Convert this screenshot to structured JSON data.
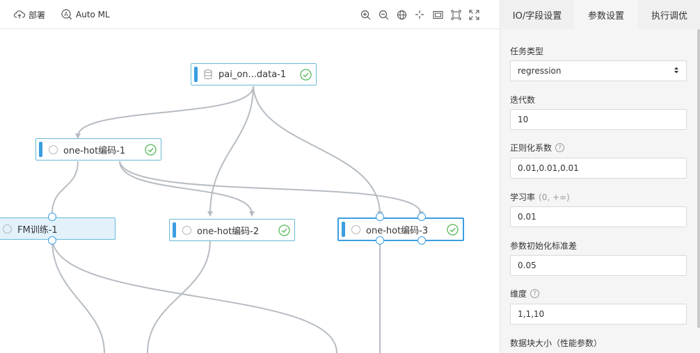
{
  "toolbar": {
    "deploy_label": "部署",
    "automl_label": "Auto ML"
  },
  "graph": {
    "nodes": [
      {
        "label": "pai_on...data-1",
        "icon": "database-icon",
        "status": "success"
      },
      {
        "label": "one-hot编码-1",
        "icon": "circle-icon",
        "status": "success"
      },
      {
        "label": "FM训练-1",
        "icon": "circle-icon",
        "status": "none"
      },
      {
        "label": "one-hot编码-2",
        "icon": "circle-icon",
        "status": "success"
      },
      {
        "label": "one-hot编码-3",
        "icon": "circle-icon",
        "status": "success"
      }
    ]
  },
  "panel": {
    "tabs": [
      "IO/字段设置",
      "参数设置",
      "执行调优"
    ],
    "active_tab": "参数设置",
    "fields": [
      {
        "label": "任务类型",
        "value": "regression",
        "type": "select"
      },
      {
        "label": "迭代数",
        "value": "10"
      },
      {
        "label": "正则化系数",
        "value": "0.01,0.01,0.01",
        "help": true
      },
      {
        "label": "学习率",
        "hint": "(0, +∞)",
        "value": "0.01"
      },
      {
        "label": "参数初始化标准差",
        "value": "0.05"
      },
      {
        "label": "维度",
        "value": "1,1,10",
        "help": true
      },
      {
        "label": "数据块大小（性能参数）"
      }
    ]
  },
  "colors": {
    "accent": "#3a9ee0",
    "success": "#6cc06c",
    "edge": "#b6bcc2"
  }
}
